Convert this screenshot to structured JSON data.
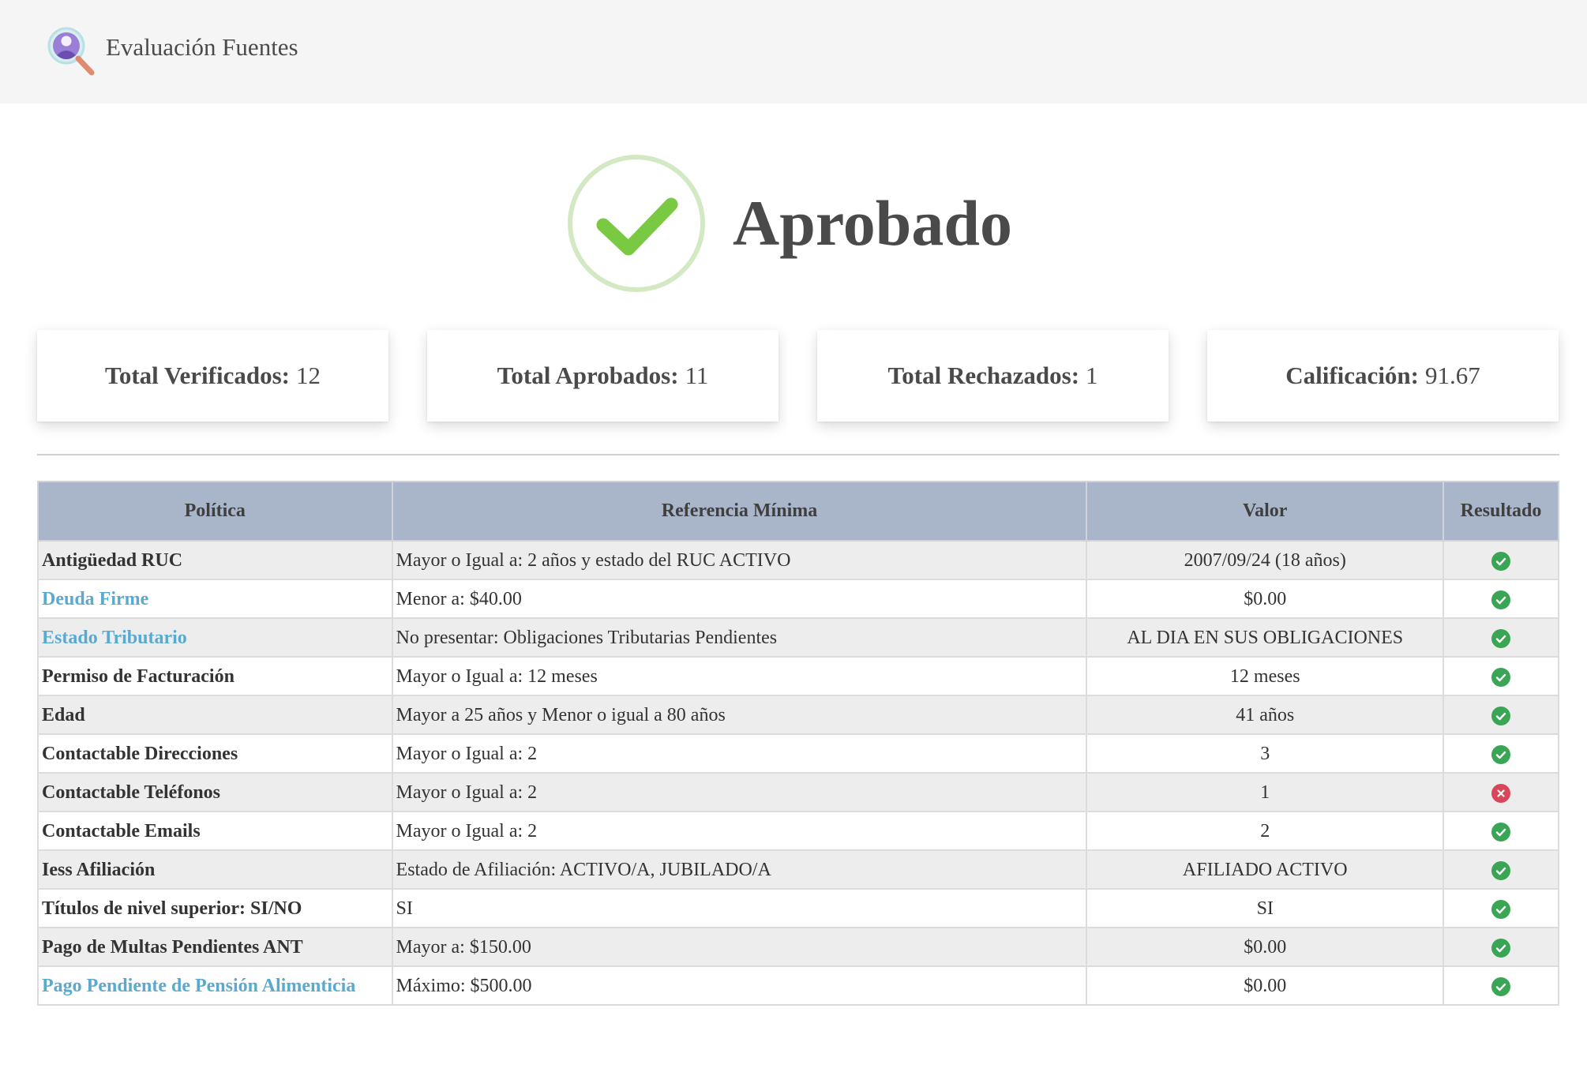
{
  "header": {
    "title": "Evaluación Fuentes"
  },
  "status": {
    "text": "Aprobado",
    "color": "#7ac943"
  },
  "stats": [
    {
      "label": "Total Verificados:",
      "value": "12"
    },
    {
      "label": "Total Aprobados:",
      "value": "11"
    },
    {
      "label": "Total Rechazados:",
      "value": "1"
    },
    {
      "label": "Calificación:",
      "value": "91.67"
    }
  ],
  "table": {
    "columns": [
      "Política",
      "Referencia Mínima",
      "Valor",
      "Resultado"
    ],
    "rows": [
      {
        "policy": "Antigüedad RUC",
        "reference": "Mayor o Igual a: 2 años y estado del RUC ACTIVO",
        "value": "2007/09/24 (18 años)",
        "result": "pass"
      },
      {
        "policy": "Deuda Firme",
        "reference": "Menor a: $40.00",
        "value": "$0.00",
        "result": "pass"
      },
      {
        "policy": "Estado Tributario",
        "reference": "No presentar: Obligaciones Tributarias Pendientes",
        "value": "AL DIA EN SUS OBLIGACIONES",
        "result": "pass"
      },
      {
        "policy": "Permiso de Facturación",
        "reference": "Mayor o Igual a: 12 meses",
        "value": "12 meses",
        "result": "pass"
      },
      {
        "policy": "Edad",
        "reference": "Mayor a 25 años y Menor o igual a 80 años",
        "value": "41 años",
        "result": "pass"
      },
      {
        "policy": "Contactable Direcciones",
        "reference": "Mayor o Igual a: 2",
        "value": "3",
        "result": "pass"
      },
      {
        "policy": "Contactable Teléfonos",
        "reference": "Mayor o Igual a: 2",
        "value": "1",
        "result": "fail"
      },
      {
        "policy": "Contactable Emails",
        "reference": "Mayor o Igual a: 2",
        "value": "2",
        "result": "pass"
      },
      {
        "policy": "Iess Afiliación",
        "reference": "Estado de Afiliación: ACTIVO/A, JUBILADO/A",
        "value": "AFILIADO ACTIVO",
        "result": "pass"
      },
      {
        "policy": "Títulos de nivel superior: SI/NO",
        "reference": "SI",
        "value": "SI",
        "result": "pass"
      },
      {
        "policy": "Pago de Multas Pendientes ANT",
        "reference": "Mayor a: $150.00",
        "value": "$0.00",
        "result": "pass"
      },
      {
        "policy": "Pago Pendiente de Pensión Alimenticia",
        "reference": "Máximo: $500.00",
        "value": "$0.00",
        "result": "pass"
      }
    ]
  },
  "colors": {
    "pass": "#3aa655",
    "fail": "#d9465a",
    "link": "#5aaad0",
    "header_bg": "#a9b5c8"
  }
}
